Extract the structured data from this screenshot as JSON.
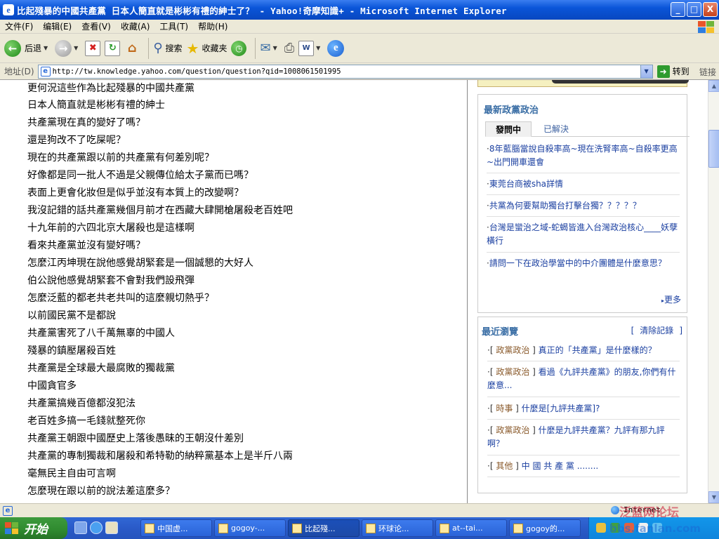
{
  "window": {
    "title": "比起殘暴的中國共產黨 日本人簡直就是彬彬有禮的紳士了？ - Yahoo!奇摩知識+ - Microsoft Internet Explorer",
    "buttons": {
      "minimize": "_",
      "maximize": "□",
      "close": "X"
    }
  },
  "menu": [
    "文件(F)",
    "编辑(E)",
    "查看(V)",
    "收藏(A)",
    "工具(T)",
    "帮助(H)"
  ],
  "toolbar": {
    "back_label": "后退",
    "search_label": "搜索",
    "favorites_label": "收藏夹"
  },
  "address": {
    "label": "地址(D)",
    "url": "http://tw.knowledge.yahoo.com/question/question?qid=1008061501995",
    "go_label": "转到",
    "links_label": "链接"
  },
  "post_lines": [
    "更何況這些作為比起殘暴的中國共產黨",
    "日本人簡直就是彬彬有禮的紳士",
    "共產黨現在真的變好了嗎？",
    "還是狗改不了吃屎呢？",
    "現在的共產黨跟以前的共產黨有何差別呢？",
    "好像都是同一批人不過是父親傳位給太子黨而已嗎？",
    "表面上更會化妝但是似乎並沒有本質上的改變啊？",
    "我沒記錯的話共產黨幾個月前才在西藏大肆開槍屠殺老百姓吧",
    "十九年前的六四北京大屠殺也是這樣啊",
    "看來共產黨並沒有變好嗎？",
    "怎麼江丙坤現在說他感覺胡緊套是一個誠懇的大好人",
    "伯公說他感覺胡緊套不會對我們設飛彈",
    "怎麼泛藍的都老共老共叫的這麼親切熱乎？",
    "以前國民黨不是都說",
    "共產黨害死了八千萬無辜的中國人",
    "殘暴的鎮壓屠殺百姓",
    "共產黨是全球最大最腐敗的獨裁黨",
    "中國貪官多",
    "共產黨搞幾百億都沒犯法",
    "老百姓多搞一毛錢就整死你",
    "共產黨王朝跟中國歷史上落後愚昧的王朝沒什差別",
    "共產黨的專制獨裁和屠殺和希特勒的納粹黨基本上是半斤八兩",
    "毫無民主自由可言啊",
    "怎麼現在跟以前的說法差這麼多？"
  ],
  "politics_box": {
    "title": "最新政黨政治",
    "tab_active": "發問中",
    "tab_other": "已解決",
    "items": [
      "8年藍腦當說自殺率高~現在洗腎率高~自殺率更高~出門開車還會",
      "東莞台商被sha詳情",
      "共黨為何要幫助獨台打擊台獨？？？？？",
      "台灣是蠻治之域-蛇蝎皆進入台灣政治核心____妖孽橫行",
      "請問一下在政治學當中的中介團體是什麼意思？"
    ],
    "more_label": "更多"
  },
  "recent_box": {
    "title": "最近瀏覽",
    "clear_label": "清除記錄",
    "items": [
      {
        "cat": "政黨政治",
        "text": "真正的「共產黨」是什麼樣的？"
      },
      {
        "cat": "政黨政治",
        "text": "看過《九評共產黨》的朋友,你們有什麼意..."
      },
      {
        "cat": "時事",
        "text": "什麼是[九評共產黨]?"
      },
      {
        "cat": "政黨政治",
        "text": "什麼是九評共產黨？九評有那九評啊？"
      },
      {
        "cat": "其他",
        "text": "中 國 共 產 黨 ........"
      }
    ]
  },
  "status": {
    "zone": "Internet"
  },
  "watermark": {
    "line1": "泛蓝网论坛",
    "line2": "bbs.fanlan.com"
  },
  "taskbar": {
    "start_label": "开始",
    "tasks": [
      "中国虚...",
      "gogoy-...",
      "比起殘...",
      "环球论...",
      "at--tai...",
      "gogoy的..."
    ],
    "active_index": 2,
    "clock": ""
  }
}
